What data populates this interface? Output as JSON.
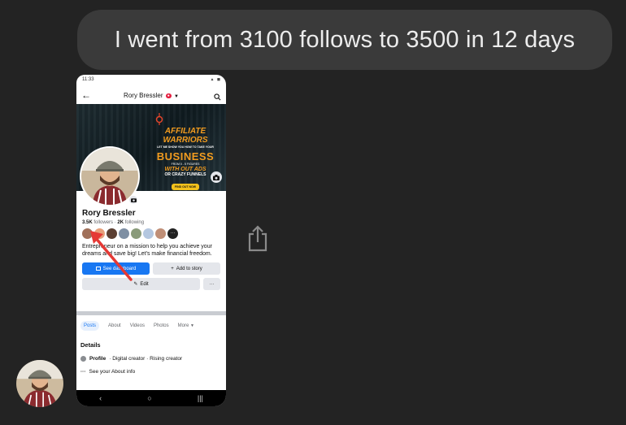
{
  "message": {
    "text": "I went from 3100 follows to 3500 in 12 days"
  },
  "phone": {
    "status_time": "11:33",
    "header": {
      "title": "Rory Bressler"
    },
    "cover": {
      "line1": "AFFILIATE WARRIORS",
      "line2": "LET ME SHOW YOU HOW TO TAKE YOUR",
      "line3": "BUSINESS",
      "line4": "FROM 0 - 5 FIGURES",
      "line5": "WITH OUT ADS",
      "line6": "OR CRAZY FUNNELS",
      "cta": "FIND OUT NOW"
    },
    "profile": {
      "name": "Rory Bressler",
      "followers_count": "3.5K",
      "followers_label": "followers",
      "following_count": "2K",
      "following_label": "following",
      "bio": "Entrepreneur on a mission to help you achieve your dreams and save big! Let's make financial freedom."
    },
    "buttons": {
      "dashboard": "See dashboard",
      "story": "Add to story",
      "edit": "Edit",
      "more": "···"
    },
    "tabs": [
      "Posts",
      "About",
      "Videos",
      "Photos",
      "More"
    ],
    "details": {
      "heading": "Details",
      "profile_label": "Profile",
      "profile_text": "· Digital creator · Rising creator",
      "about_link": "See your About info"
    }
  },
  "colors": {
    "accent": "#1877f2",
    "bubble": "#3a3a3a",
    "annotation_arrow": "#e53935",
    "cover_orange": "#f29c1f"
  },
  "icons": [
    "back-arrow-icon",
    "search-icon",
    "camera-icon",
    "share-icon",
    "pencil-icon",
    "plus-icon",
    "dashboard-icon"
  ]
}
